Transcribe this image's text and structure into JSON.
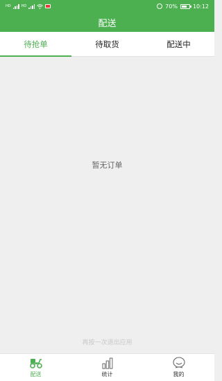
{
  "status_bar": {
    "battery": "70%",
    "time": "10:12",
    "battery_level": 0.7
  },
  "header": {
    "title": "配送"
  },
  "tabs": [
    {
      "label": "待抢单",
      "active": true
    },
    {
      "label": "待取货",
      "active": false
    },
    {
      "label": "配送中",
      "active": false
    }
  ],
  "main": {
    "empty_text": "暂无订单",
    "toast": "再按一次退出应用"
  },
  "bottom_nav": [
    {
      "label": "配送",
      "icon": "scooter-icon",
      "active": true
    },
    {
      "label": "统计",
      "icon": "bar-chart-icon",
      "active": false
    },
    {
      "label": "我的",
      "icon": "profile-icon",
      "active": false
    }
  ],
  "colors": {
    "accent": "#4caf50"
  }
}
